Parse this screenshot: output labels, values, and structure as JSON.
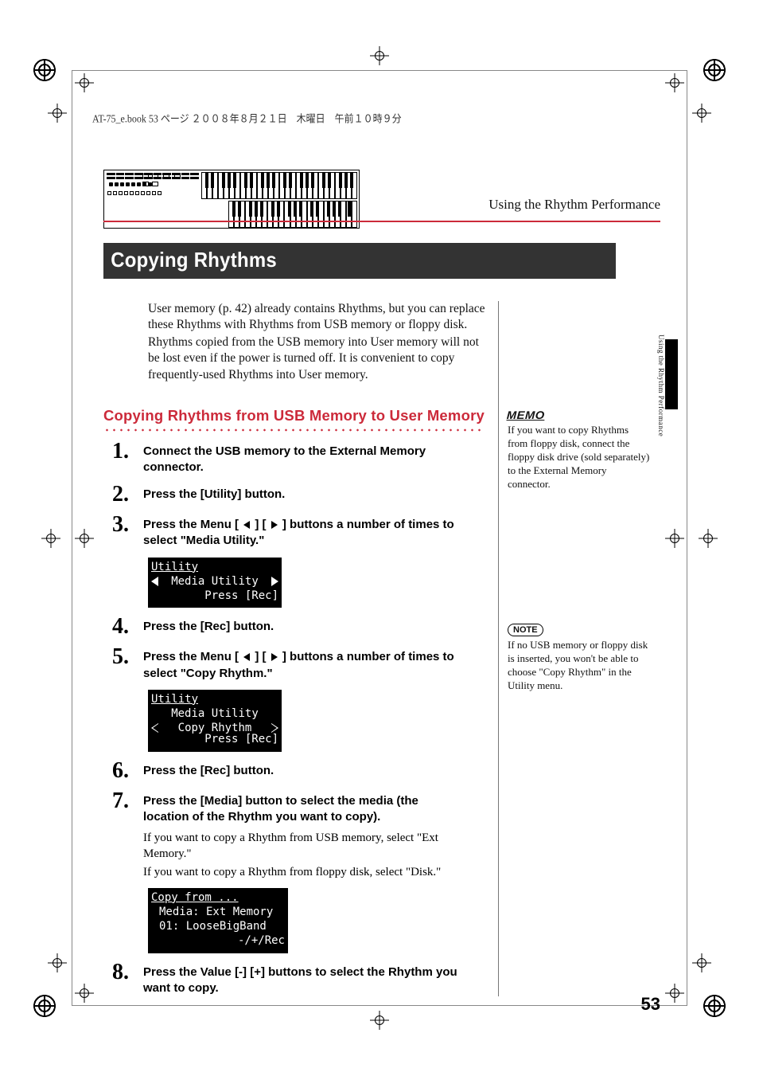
{
  "page_meta_line": "AT-75_e.book 53 ページ ２００８年８月２１日　木曜日　午前１０時９分",
  "running_head": "Using the Rhythm Performance",
  "section_title": "Copying Rhythms",
  "intro_p1": "User memory (p. 42) already contains Rhythms, but you can replace these Rhythms with Rhythms from USB memory or floppy disk.",
  "intro_p2": "Rhythms copied from the USB memory into User memory will not be lost even if the power is turned off. It is convenient to copy frequently-used Rhythms into User memory.",
  "subheading": "Copying Rhythms from USB Memory to User Memory",
  "steps": {
    "s1": "Connect the USB memory to the External Memory connector.",
    "s2": "Press the [Utility] button.",
    "s3a": "Press the Menu [ ",
    "s3b": " ] [ ",
    "s3c": " ] buttons a number of times to select \"Media Utility.\"",
    "s4": "Press the [Rec] button.",
    "s5a": "Press the Menu [ ",
    "s5b": " ] [ ",
    "s5c": " ] buttons a number of times to select \"Copy Rhythm.\"",
    "s6": "Press the [Rec] button.",
    "s7": "Press the [Media] button to select the media (the location of the Rhythm you want to copy).",
    "s7_sub1": "If you want to copy a Rhythm from USB memory, select \"Ext Memory.\"",
    "s7_sub2": "If you want to copy a Rhythm from floppy disk, select \"Disk.\"",
    "s8": "Press the Value [-] [+] buttons to select the Rhythm you want to copy."
  },
  "lcd1": {
    "header": "Utility",
    "line": "Media Utility",
    "footer": "Press [Rec]"
  },
  "lcd2": {
    "header": "Utility",
    "line1": "Media Utility",
    "line2": "Copy Rhythm",
    "footer": "Press [Rec]"
  },
  "lcd3": {
    "header": "Copy from ...",
    "line1": "Media: Ext Memory",
    "line2": "01: LooseBigBand",
    "footer": "-/+/Rec"
  },
  "memo": {
    "label": "MEMO",
    "text": "If you want to copy Rhythms from floppy disk, connect the floppy disk drive (sold separately) to the External Memory connector."
  },
  "note": {
    "label": "NOTE",
    "text": "If no USB memory or floppy disk is inserted, you won't be able to choose \"Copy Rhythm\" in the Utility menu."
  },
  "side_text": "Using the Rhythm Performance",
  "page_number": "53"
}
